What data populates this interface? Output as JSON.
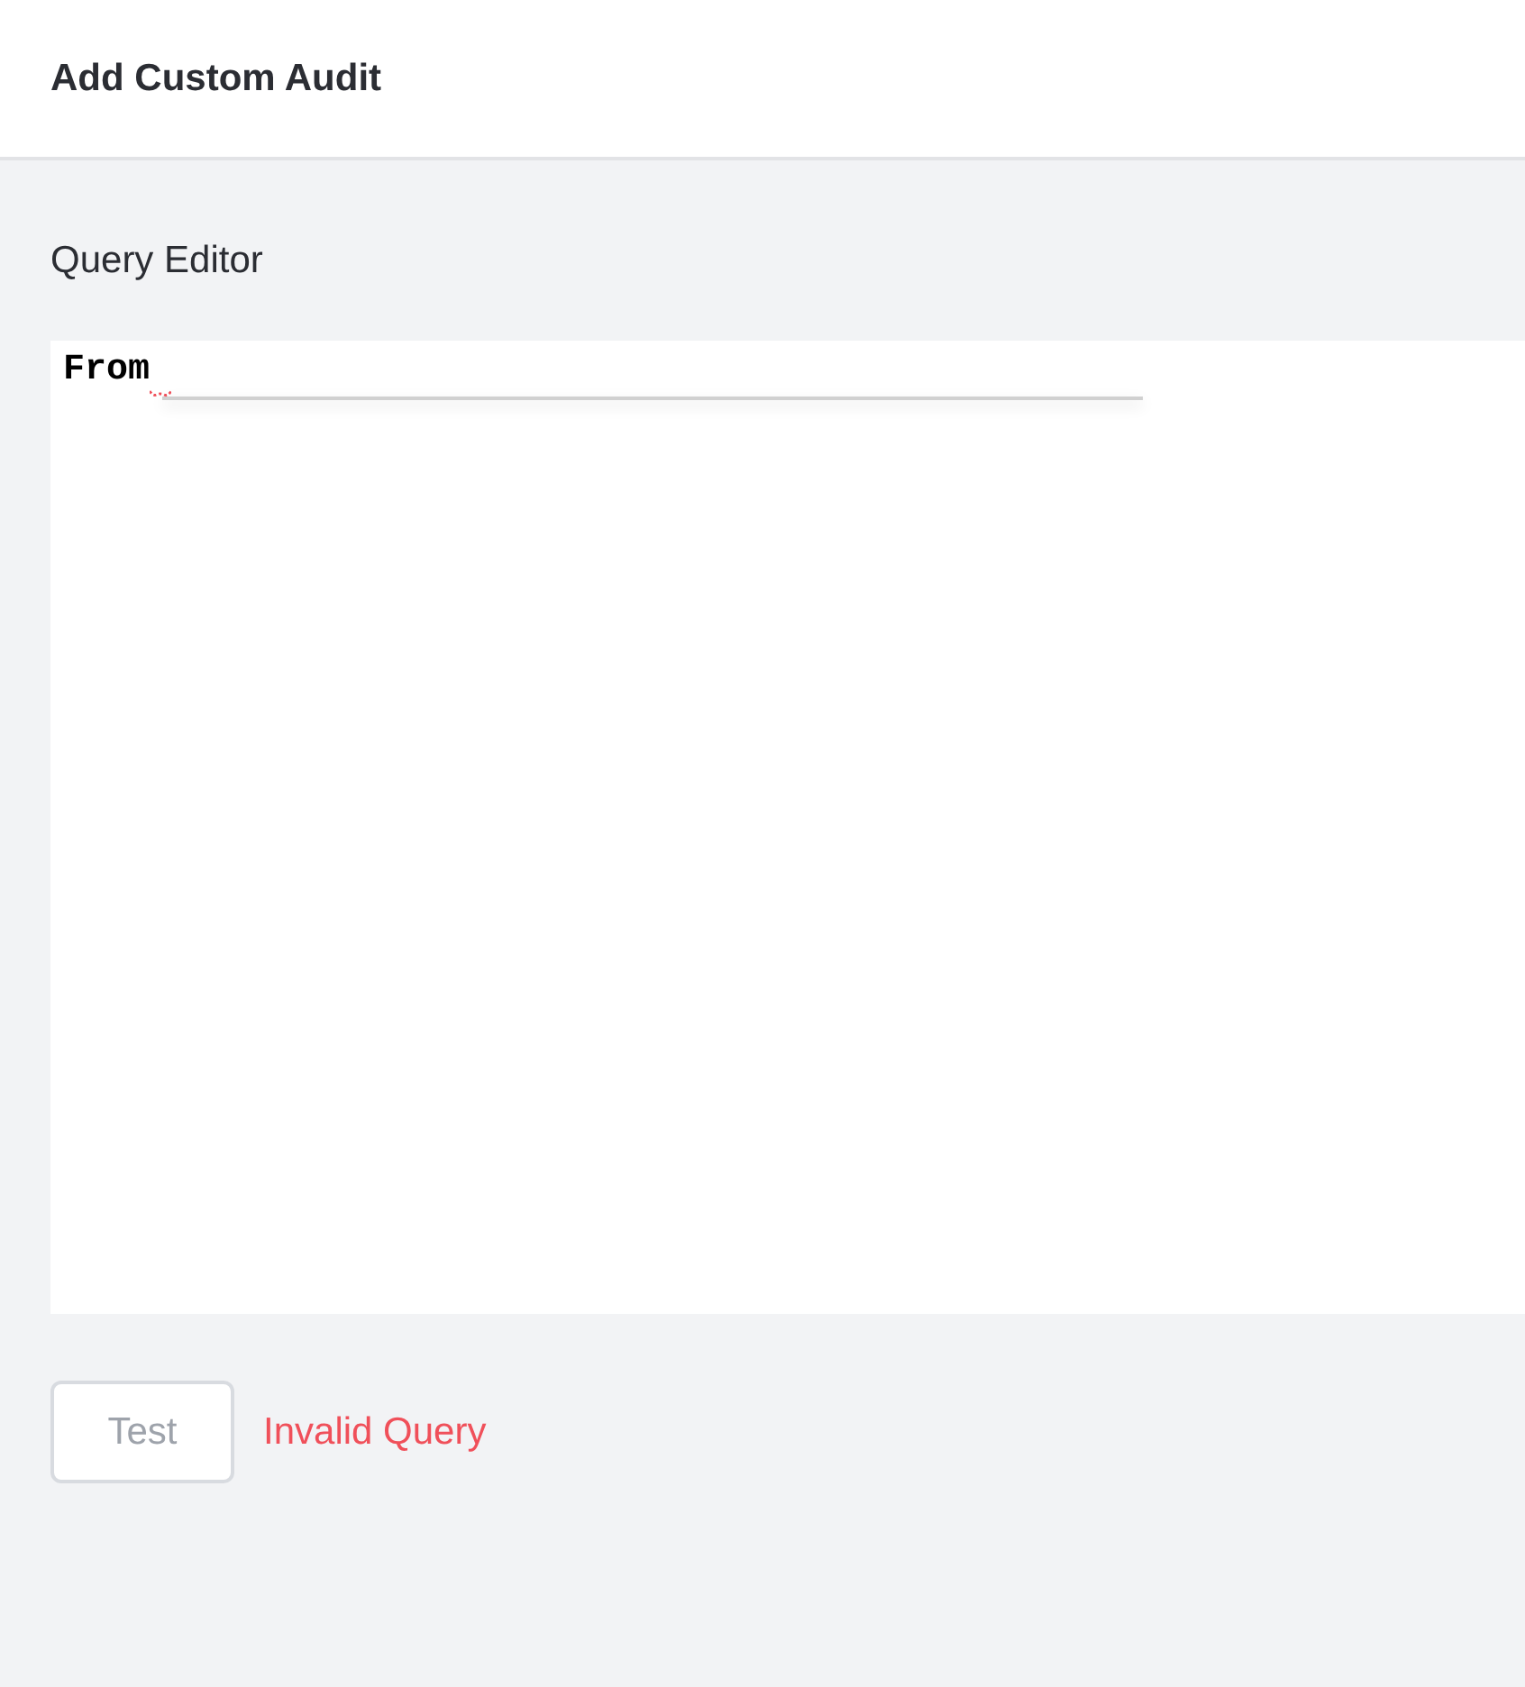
{
  "header": {
    "title": "Add Custom Audit"
  },
  "editor": {
    "label": "Query Editor",
    "code": "From",
    "has_error": true,
    "suggestions_open": true
  },
  "test_button": {
    "label": "Test",
    "disabled": true
  },
  "status": {
    "message": "Invalid Query",
    "kind": "error"
  }
}
